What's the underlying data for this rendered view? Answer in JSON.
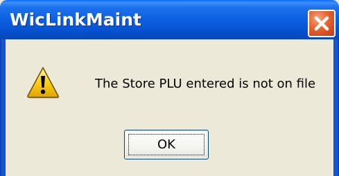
{
  "window": {
    "title": "WicLinkMaint",
    "close_icon": "close-icon"
  },
  "dialog": {
    "icon": "warning-icon",
    "message": "The Store PLU entered is not on file",
    "ok_label": "OK"
  },
  "colors": {
    "titlebar": "#0a5ee0",
    "dialog_background": "#ece9d8",
    "close_button": "#e5632f",
    "warning_yellow": "#ffd21e",
    "text": "#000000"
  }
}
